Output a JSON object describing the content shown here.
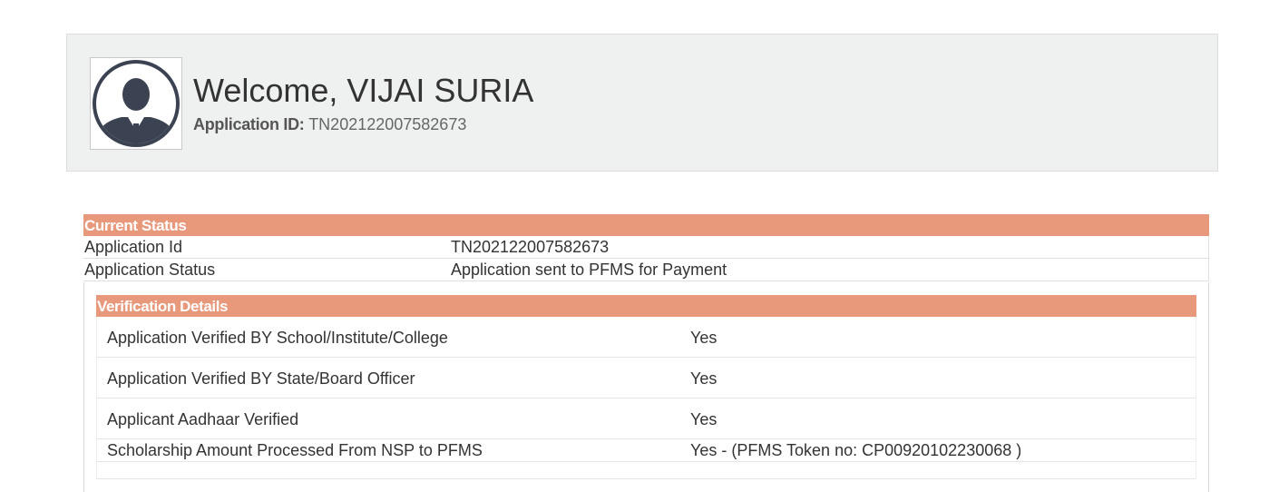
{
  "welcome": {
    "title": "Welcome, VIJAI SURIA",
    "app_id_label": "Application ID:",
    "app_id_value": "TN202122007582673",
    "avatar_icon": "user-avatar-icon"
  },
  "current_status": {
    "header": "Current Status",
    "rows": [
      {
        "label": "Application Id",
        "value": "TN202122007582673"
      },
      {
        "label": "Application Status",
        "value": "Application sent to PFMS for Payment"
      }
    ]
  },
  "verification": {
    "header": "Verification Details",
    "rows": [
      {
        "label": "Application Verified BY School/Institute/College",
        "value": "Yes"
      },
      {
        "label": "Application Verified BY State/Board Officer",
        "value": "Yes"
      },
      {
        "label": "Applicant Aadhaar Verified",
        "value": "Yes"
      },
      {
        "label": "Scholarship Amount Processed From NSP to PFMS",
        "value": "Yes - (PFMS Token no: CP00920102230068 )"
      }
    ]
  },
  "colors": {
    "header_bg": "#e8997c",
    "panel_bg": "#eff0f0",
    "avatar_dark": "#3b4352"
  }
}
